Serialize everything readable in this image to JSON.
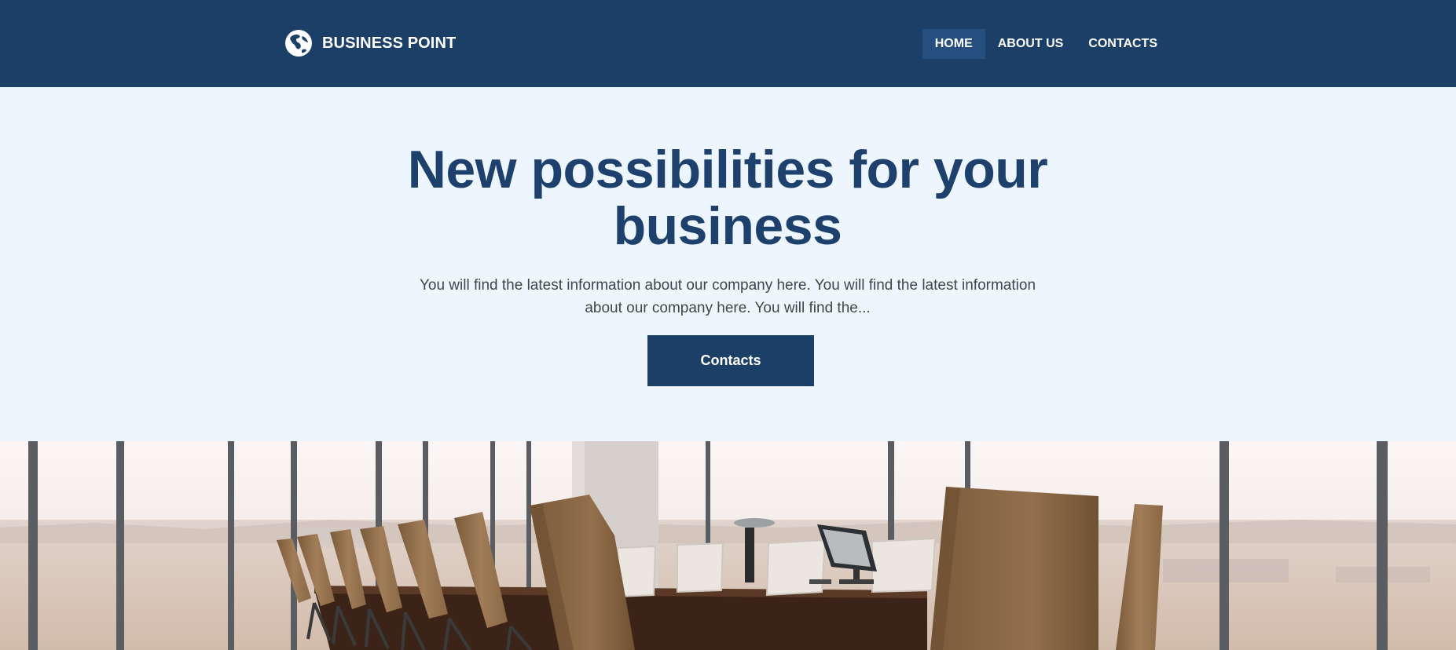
{
  "header": {
    "brand": {
      "logo_icon": "globe-icon",
      "name": "BUSINESS POINT"
    },
    "nav": [
      {
        "label": "HOME",
        "active": true
      },
      {
        "label": "ABOUT US",
        "active": false
      },
      {
        "label": "CONTACTS",
        "active": false
      }
    ]
  },
  "hero": {
    "title": "New possibilities for your business",
    "text": "You will find the latest information about our company here. You will find the latest information about our company here. You will find the...",
    "button_label": "Contacts"
  },
  "colors": {
    "header_bg": "#1b3f66",
    "active_nav_bg": "#244f7e",
    "hero_bg": "#edf5fe",
    "title": "#1d406c",
    "body_text": "#3f4650"
  }
}
